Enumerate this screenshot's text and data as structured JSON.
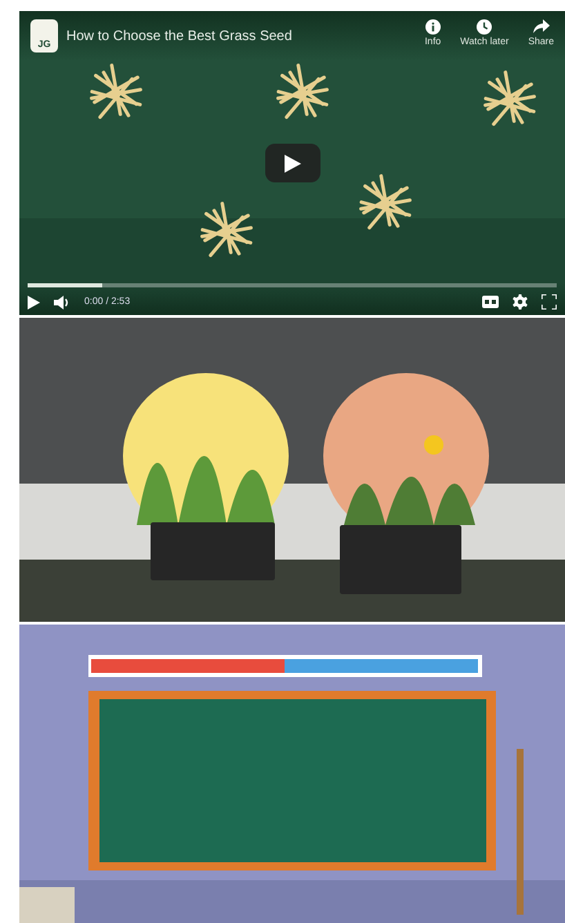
{
  "player": {
    "channel_avatar": "JG",
    "title": "How to Choose the Best Grass Seed",
    "actions": [
      {
        "kind": "info",
        "label": "Info"
      },
      {
        "kind": "clock",
        "label": "Watch later"
      },
      {
        "kind": "share",
        "label": "Share"
      }
    ],
    "progress": {
      "level": 0.14
    },
    "time": "0:00 / 2:53",
    "controls": [
      {
        "kind": "captions"
      },
      {
        "kind": "settings"
      },
      {
        "kind": "fullscreen"
      }
    ]
  }
}
